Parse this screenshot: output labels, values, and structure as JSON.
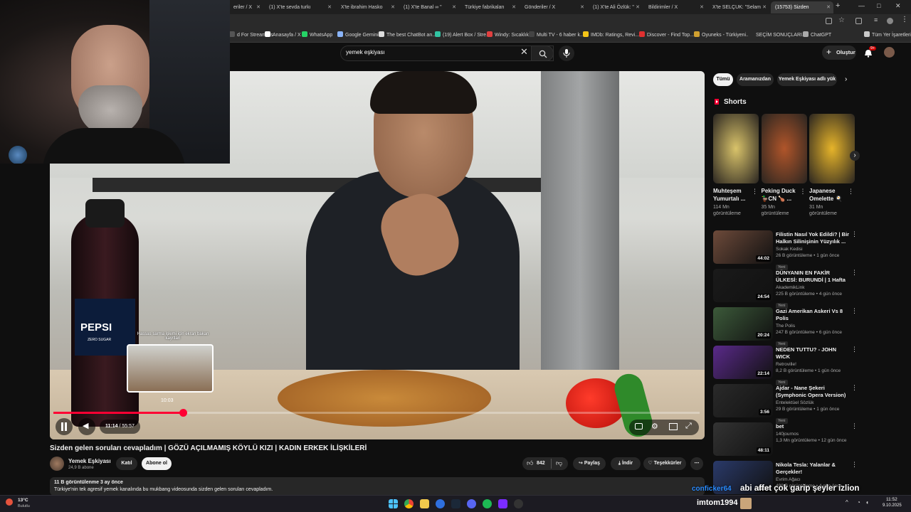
{
  "tabs": [
    {
      "label": "eriler / X",
      "active": false
    },
    {
      "label": "(1) X'te sevda turkı",
      "active": false
    },
    {
      "label": "X'te ibrahim Hasko",
      "active": false
    },
    {
      "label": "(1) X'te Banal ∞ \"",
      "active": false
    },
    {
      "label": "Türkiye fabrikaları",
      "active": false
    },
    {
      "label": "Gönderiler / X",
      "active": false
    },
    {
      "label": "(1) X'te Ali Özlük: \"",
      "active": false
    },
    {
      "label": "Bildirimler / X",
      "active": false
    },
    {
      "label": "X'te SELÇUK: \"Selam",
      "active": false
    },
    {
      "label": "(15753) Sizden",
      "active": true
    }
  ],
  "bookmarks": [
    {
      "label": "d For Streamers",
      "color": "#555555"
    },
    {
      "label": "Anasayfa / X",
      "color": "#ffffff"
    },
    {
      "label": "WhatsApp",
      "color": "#25d366"
    },
    {
      "label": "Google Gemini",
      "color": "#8ab4f8"
    },
    {
      "label": "The best ChatBot an...",
      "color": "#dddddd"
    },
    {
      "label": "(19) Alert Box / Stre...",
      "color": "#31c3a2"
    },
    {
      "label": "Windy: Sıcaklık",
      "color": "#e04040"
    },
    {
      "label": "Multi TV - 6 haber k...",
      "color": "#444444"
    },
    {
      "label": "IMDb: Ratings, Revi...",
      "color": "#f5c518"
    },
    {
      "label": "Discover - Find Top...",
      "color": "#e03030"
    },
    {
      "label": "Oyuneks - Türkiyeni...",
      "color": "#d0a030"
    },
    {
      "label": "SEÇİM SONUÇLARI...",
      "color": "#2a2a2a"
    },
    {
      "label": "ChatGPT",
      "color": "#aaaaaa"
    }
  ],
  "bookmarks_all": "Tüm Yer İşaretleri",
  "search": {
    "query": "yemek eşkiyası"
  },
  "header": {
    "create_label": "Oluştur",
    "notif_count": "9+"
  },
  "player": {
    "current_time": "11:14",
    "duration": "55:57",
    "time_display": "11:14 / 55:57",
    "progress_fraction": 0.2,
    "hover_time": "10:03",
    "hover_caption": "Hassas sarma işlemi için ekran bakan kayıtları",
    "bottle_brand": "PEPSI",
    "bottle_sub": "ZERO SUGAR"
  },
  "video": {
    "title": "Sizden gelen soruları cevapladım | GÖZÜ AÇILMAMIŞ KÖYLÜ KIZI | KADIN ERKEK İLİŞKİLERİ",
    "channel_name": "Yemek Eşkiyası",
    "subscribers": "24,9 B abone",
    "join_label": "Katıl",
    "subscribe_label": "Abone ol",
    "likes": "842",
    "share_label": "Paylaş",
    "download_label": "İndir",
    "thanks_label": "Teşekkürler",
    "views_line": "11 B görüntülenme  3 ay önce",
    "description": "Türkiye'nin tek agresif yemek kanalında bu mukbang videosunda sizden gelen soruları cevapladım."
  },
  "chips": [
    "Tümü",
    "Aramanızdan",
    "Yemek Eşkiyası adlı yük"
  ],
  "shorts": {
    "heading": "Shorts",
    "items": [
      {
        "title": "Muhteşem Yumurtalı ...",
        "views": "114 Mn görüntüleme",
        "color": "#d9c36a"
      },
      {
        "title": "Peking Duck 🦆CN 🍗 ...",
        "views": "35 Mn görüntüleme",
        "color": "#b0552a"
      },
      {
        "title": "Japanese Omelette 🍳",
        "views": "31 Mn görüntüleme",
        "color": "#e6b42a"
      }
    ]
  },
  "related": [
    {
      "title": "Filistin Nasıl Yok Edildi? | Bir Halkın Silinişinin Yüzyılık ...",
      "channel": "Sokak Kedisi",
      "stats": "26 B görüntüleme • 1 gün önce",
      "duration": "44:02",
      "badge": "Yeni",
      "color": "#6d4a3a"
    },
    {
      "title": "DÜNYANIN EN FAKİR ÜLKESİ: BURUNDİ | 1 Hafta Boyunca ...",
      "channel": "AkademikLink",
      "stats": "225 B görüntüleme • 4 gün önce",
      "duration": "24:54",
      "badge": "Yeni",
      "color": "#1a1a1a"
    },
    {
      "title": "Gazi Amerikan Askeri Vs 8 Polis",
      "channel": "The Polis",
      "stats": "247 B görüntüleme • 6 gün önce",
      "duration": "20:24",
      "badge": "Yeni",
      "color": "#3c5a3a"
    },
    {
      "title": "NEDEN TUTTU? - JOHN WICK",
      "channel": "Retroville!",
      "stats": "8,2 B görüntüleme • 1 gün önce",
      "duration": "22:14",
      "badge": "Yeni",
      "color": "#5a2a8a"
    },
    {
      "title": "Ajdar - Nane Şekeri (Symphonic Opera Version)",
      "channel": "Entelektüel Sözlük",
      "stats": "29 B görüntüleme • 1 gün önce",
      "duration": "3:56",
      "badge": "Yeni",
      "color": "#2a2a2a"
    },
    {
      "title": "bet",
      "channel": "140journos",
      "stats": "1,3 Mn görüntüleme • 12 gün önce",
      "duration": "48:11",
      "badge": "",
      "color": "#333333"
    },
    {
      "title": "Nikola Tesla: Yalanlar & Gerçekler!",
      "channel": "Evrim Ağacı",
      "stats": "499 B görüntüleme • 4 gün önce",
      "duration": "35:22",
      "badge": "",
      "color": "#2a3a6a"
    }
  ],
  "overlay": {
    "chat_user": "conficker64",
    "chat_text": "abi affet çok garip şeyler izlion",
    "streamer_name": "imtom1994"
  },
  "taskbar": {
    "weather_temp": "13°C",
    "weather_desc": "Bulutlu",
    "time": "11:52",
    "date": "9.10.2025"
  },
  "colors": {
    "accent_red": "#ff0033",
    "background": "#0f0f0f"
  }
}
